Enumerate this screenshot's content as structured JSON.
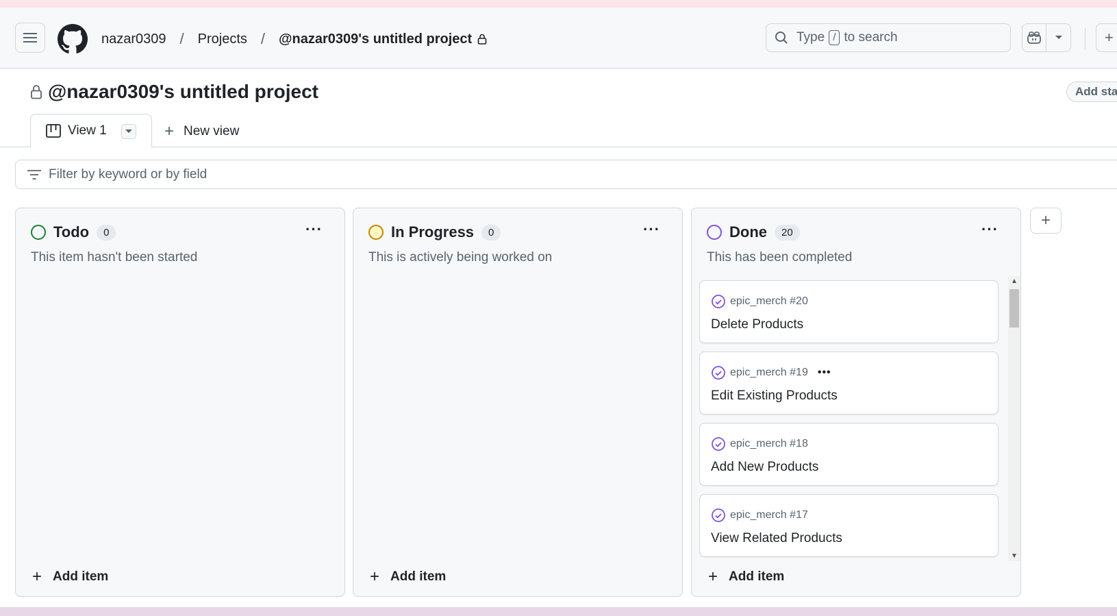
{
  "header": {
    "user": "nazar0309",
    "projects": "Projects",
    "project": "@nazar0309's untitled project",
    "search_type": "Type",
    "search_key": "/",
    "search_suffix": "to search"
  },
  "project": {
    "title": "@nazar0309's untitled project",
    "add_status": "Add status"
  },
  "tabs": {
    "view1": "View 1",
    "new_view": "New view"
  },
  "filter": {
    "placeholder": "Filter by keyword or by field"
  },
  "columns": [
    {
      "name": "Todo",
      "count": "0",
      "description": "This item hasn't been started",
      "color": "#1a7f37"
    },
    {
      "name": "In Progress",
      "count": "0",
      "description": "This is actively being worked on",
      "color": "#bf8700"
    },
    {
      "name": "Done",
      "count": "20",
      "description": "This has been completed",
      "color": "#8250df"
    }
  ],
  "cards": [
    {
      "ref": "epic_merch #20",
      "title": "Delete Products"
    },
    {
      "ref": "epic_merch #19",
      "title": "Edit Existing Products"
    },
    {
      "ref": "epic_merch #18",
      "title": "Add New Products"
    },
    {
      "ref": "epic_merch #17",
      "title": "View Related Products"
    }
  ],
  "add_item": "Add item"
}
